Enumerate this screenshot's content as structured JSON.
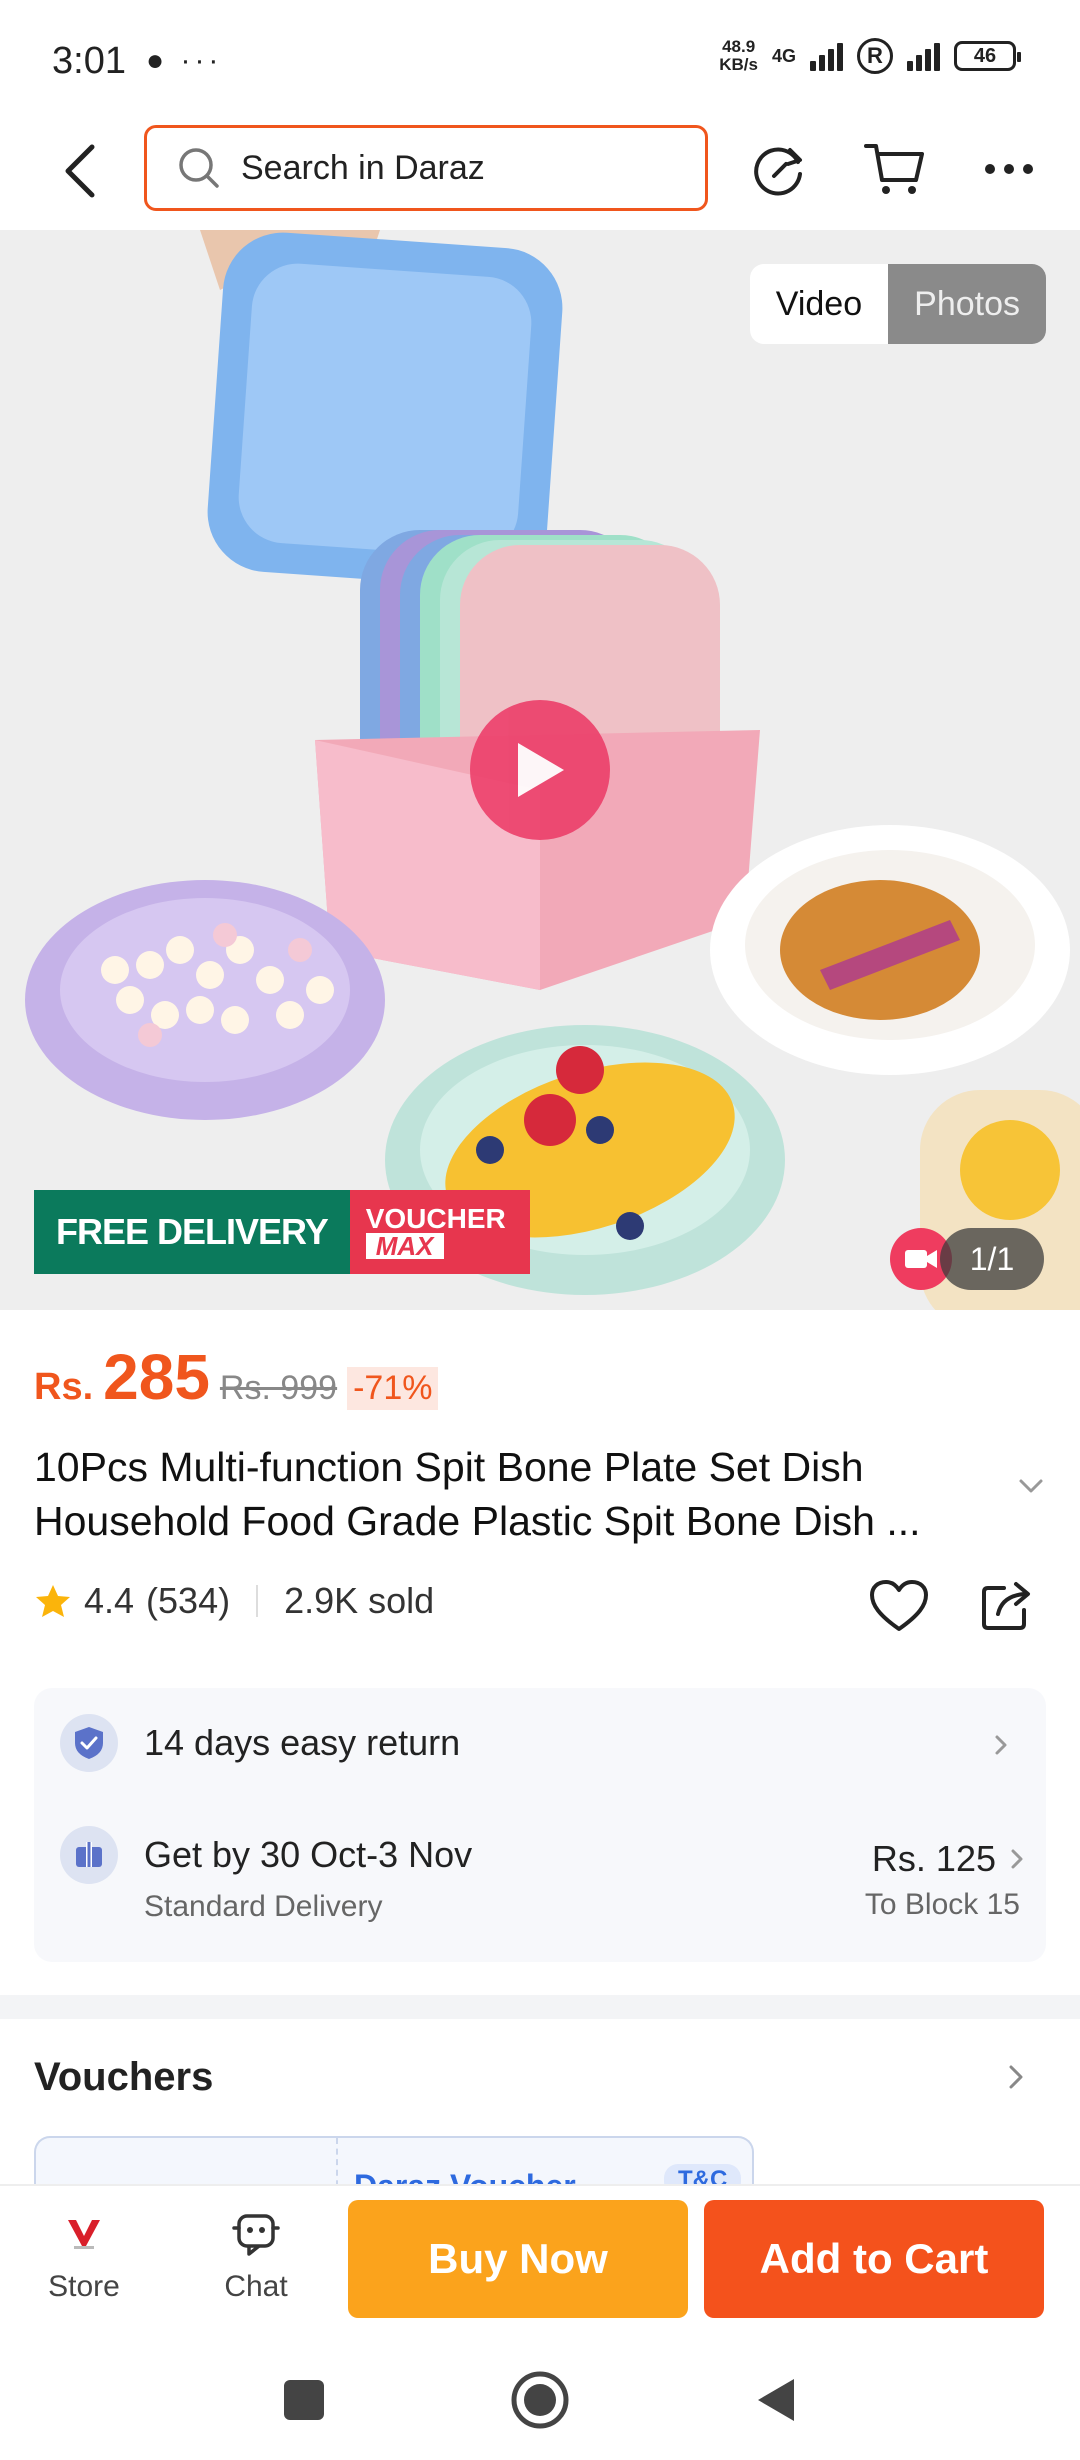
{
  "status_bar": {
    "time": "3:01",
    "left_icons": "● ···",
    "net_speed_top": "48.9",
    "net_speed_bottom": "KB/s",
    "net_type": "4G",
    "battery": "46"
  },
  "search": {
    "placeholder": "Search in Daraz"
  },
  "media": {
    "video_label": "Video",
    "photos_label": "Photos",
    "counter": "1/1"
  },
  "promo": {
    "free_delivery": "FREE DELIVERY",
    "voucher_line1": "VOUCHER",
    "voucher_line2": "MAX"
  },
  "price": {
    "currency": "Rs.",
    "current": "285",
    "original": "Rs. 999",
    "discount": "-71%"
  },
  "product": {
    "title": "10Pcs Multi-function Spit Bone Plate Set Dish Household Food Grade Plastic Spit Bone Dish ...",
    "rating": "4.4",
    "reviews": "(534)",
    "sold": "2.9K sold"
  },
  "services": {
    "return_text": "14 days easy return",
    "delivery_text": "Get by 30 Oct-3 Nov",
    "delivery_sub": "Standard Delivery",
    "delivery_price": "Rs. 125",
    "delivery_location": "To Block 15"
  },
  "vouchers": {
    "title": "Vouchers",
    "card_title": "Daraz Voucher",
    "card_tc": "T&C"
  },
  "bottom_bar": {
    "store_label": "Store",
    "chat_label": "Chat",
    "buy_now": "Buy Now",
    "add_to_cart": "Add to Cart"
  },
  "colors": {
    "brand_orange": "#f0561d",
    "buy_now": "#fba31c",
    "add_to_cart": "#f4521c",
    "free_delivery_green": "#0b7a5c",
    "voucher_red": "#e7364e"
  }
}
